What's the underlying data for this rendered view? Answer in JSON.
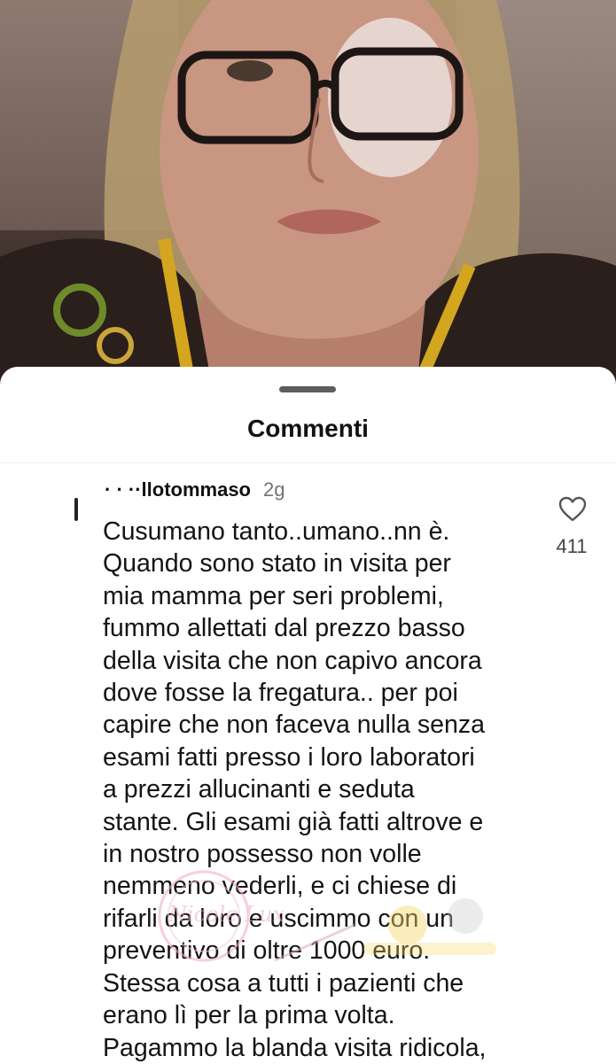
{
  "sheet": {
    "title": "Commenti"
  },
  "comment": {
    "username": "simonelloatommaso",
    "username_visible": "· · ··llotommaso",
    "timestamp": "2g",
    "text": "Cusumano tanto..umano..nn è.\nQuando sono stato in visita per\nmia mamma per seri problemi,\nfummo allettati dal prezzo basso\ndella visita che non capivo ancora\ndove fosse la fregatura.. per poi\ncapire che non faceva nulla senza\nesami fatti presso i loro laboratori\na prezzi allucinanti e seduta\nstante. Gli esami già fatti altrove e\nin nostro possesso non volle\nnemmeno vederli, e ci chiese di\nrifarli da loro e uscimmo con un\npreventivo di oltre 1000 euro.\nStessa cosa a tutti i pazienti che\nerano lì per la prima volta.\nPagammo la blanda visita ridicola,",
    "like_icon": "heart-outline-icon",
    "like_count": "411"
  },
  "watermark": {
    "text": "Nicole Lux"
  },
  "colors": {
    "sheet_bg": "#ffffff",
    "text": "#141414",
    "muted": "#737373",
    "handle": "#5d5d5d"
  }
}
